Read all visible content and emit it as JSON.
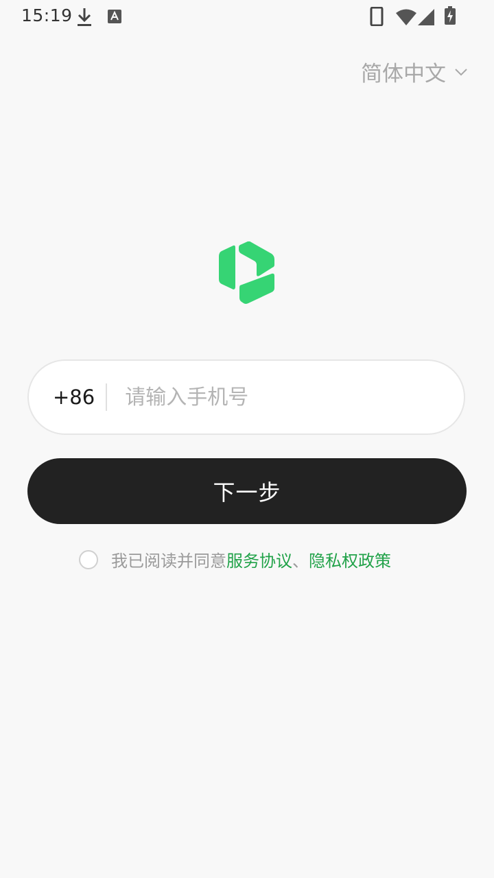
{
  "status_bar": {
    "time": "15:19",
    "left_icons": [
      "download-icon",
      "keyboard-a-icon"
    ],
    "right_icons": [
      "phone-icon",
      "wifi-icon",
      "signal-icon",
      "battery-charging-icon"
    ]
  },
  "language": {
    "selected": "简体中文",
    "icon": "chevron-down-icon"
  },
  "logo": {
    "icon": "app-logo-icon",
    "color": "#36d474"
  },
  "phone": {
    "country_code": "+86",
    "value": "",
    "placeholder": "请输入手机号"
  },
  "next_button": {
    "label": "下一步"
  },
  "agreement": {
    "prefix": "我已阅读并同意",
    "terms_link": "服务协议",
    "separator": "、",
    "privacy_link": "隐私权政策",
    "link_color": "#21a249"
  },
  "colors": {
    "background": "#f8f8f8",
    "button": "#222222",
    "accent": "#36d474"
  }
}
